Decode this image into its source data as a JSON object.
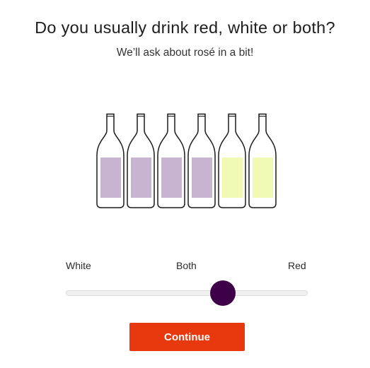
{
  "question": {
    "title": "Do you usually drink red, white or both?",
    "subtitle": "We’ll ask about rosé in a bit!"
  },
  "bottles": [
    {
      "type": "red"
    },
    {
      "type": "red"
    },
    {
      "type": "red"
    },
    {
      "type": "red"
    },
    {
      "type": "white"
    },
    {
      "type": "white"
    }
  ],
  "slider": {
    "labels": {
      "white": "White",
      "both": "Both",
      "red": "Red"
    },
    "value": 0.65
  },
  "continue_button": {
    "label": "Continue"
  },
  "colors": {
    "red_wine_label": "#c8b3d1",
    "white_wine_label": "#f2f9b5",
    "bottle_outline": "#1a1a1a",
    "slider_thumb": "#3d0049",
    "button_background": "#e8380d"
  },
  "icons": {
    "bottle": "wine-bottle-icon"
  }
}
